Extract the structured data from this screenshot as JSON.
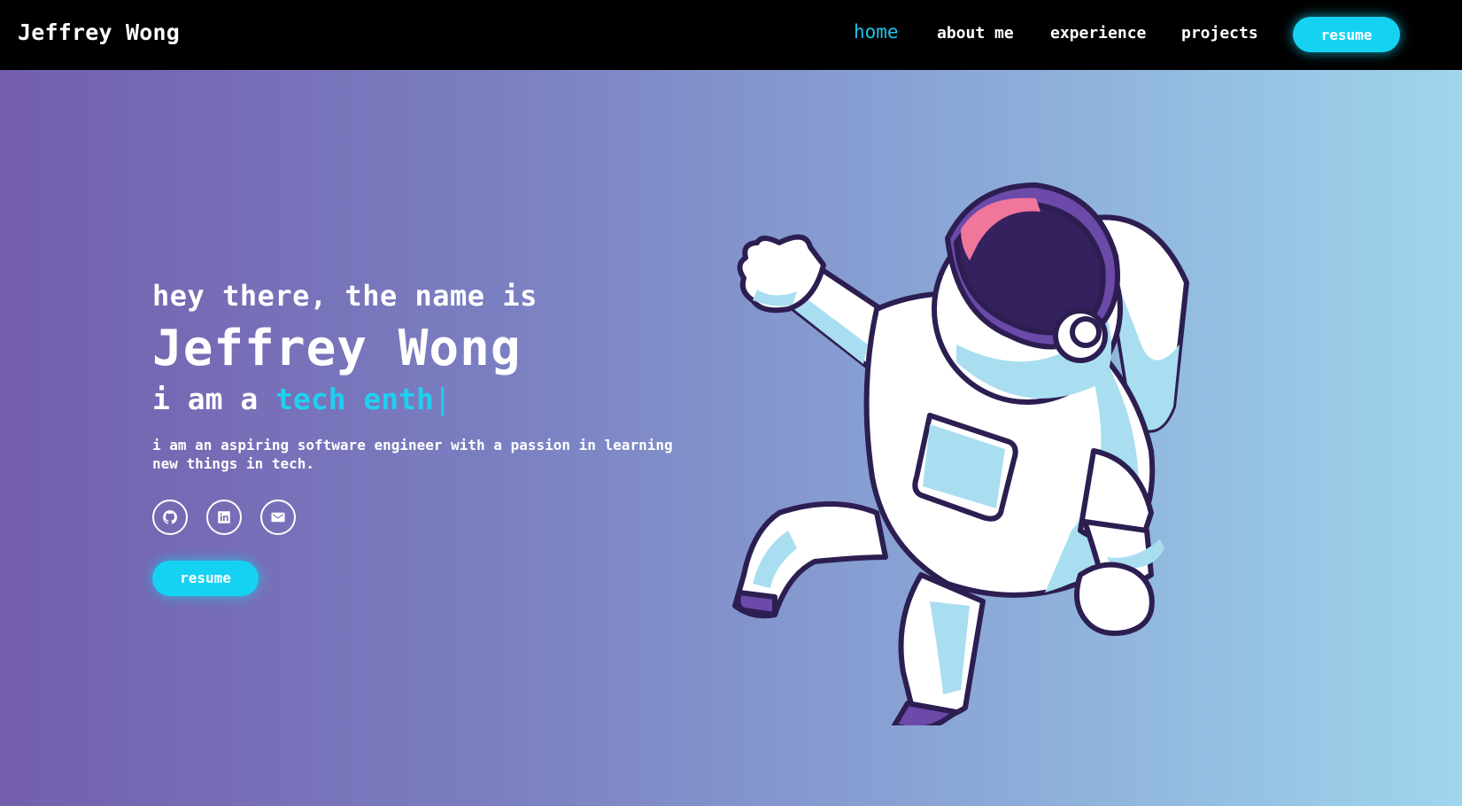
{
  "navbar": {
    "brand": "Jeffrey Wong",
    "links": [
      {
        "label": "home",
        "active": true
      },
      {
        "label": "about me",
        "active": false
      },
      {
        "label": "experience",
        "active": false
      },
      {
        "label": "projects",
        "active": false
      }
    ],
    "resume_label": "resume"
  },
  "hero": {
    "greeting": "hey there, the name is",
    "name": "Jeffrey Wong",
    "typing_prefix": "i am a",
    "typing_text": "tech enth",
    "typing_cursor": "|",
    "tagline": "i am an aspiring software engineer with a passion in learning new things in tech.",
    "socials": [
      "github-icon",
      "linkedin-icon",
      "mail-icon"
    ],
    "resume_label": "resume",
    "illustration": "astronaut-illustration"
  },
  "colors": {
    "accent": "#16d2f2",
    "navbar_bg": "#000000",
    "gradient_start": "#735ead",
    "gradient_end": "#9ed6ec"
  }
}
